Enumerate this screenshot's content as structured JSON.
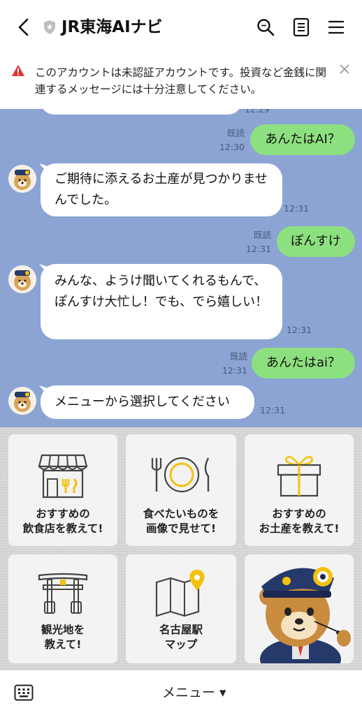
{
  "header": {
    "title": "JR東海AIナビ"
  },
  "warning": {
    "text": "このアカウントは未認証アカウントです。投資など金銭に関連するメッセージには十分注意してください。"
  },
  "messages": [
    {
      "from": "user",
      "text": "あんたはAI？",
      "read": "既読",
      "time": "12:30"
    },
    {
      "from": "bot",
      "text": "ご期待に添えるお土産が見つかりませんでした。",
      "time": "12:31"
    },
    {
      "from": "user",
      "text": "ぽんすけ",
      "read": "既読",
      "time": "12:31"
    },
    {
      "from": "bot",
      "text": "みんな、ようけ聞いてくれるもんで、ぽんすけ大忙し！でも、でら嬉しい！",
      "time": "12:31"
    },
    {
      "from": "user",
      "text": "あんたはai？",
      "read": "既読",
      "time": "12:31"
    },
    {
      "from": "bot",
      "text": "メニューから選択してください",
      "time": "12:31"
    }
  ],
  "partial_time": "12:29",
  "menu": {
    "tiles": [
      {
        "label1": "おすすめの",
        "label2": "飲食店を教えて!",
        "icon": "restaurant-icon"
      },
      {
        "label1": "食べたいものを",
        "label2": "画像で見せて!",
        "icon": "plate-icon"
      },
      {
        "label1": "おすすめの",
        "label2": "お土産を教えて!",
        "icon": "gift-icon"
      },
      {
        "label1": "観光地を",
        "label2": "教えて!",
        "icon": "torii-icon"
      },
      {
        "label1": "名古屋駅",
        "label2": "マップ",
        "icon": "map-icon"
      }
    ]
  },
  "bottom": {
    "menu_label": "メニュー ▾"
  },
  "colors": {
    "chat_bg": "#8ba4d4",
    "user_bubble": "#8de07f",
    "bot_bubble": "#ffffff",
    "warning_red": "#e0312f",
    "accent_gold": "#f4c20d"
  }
}
